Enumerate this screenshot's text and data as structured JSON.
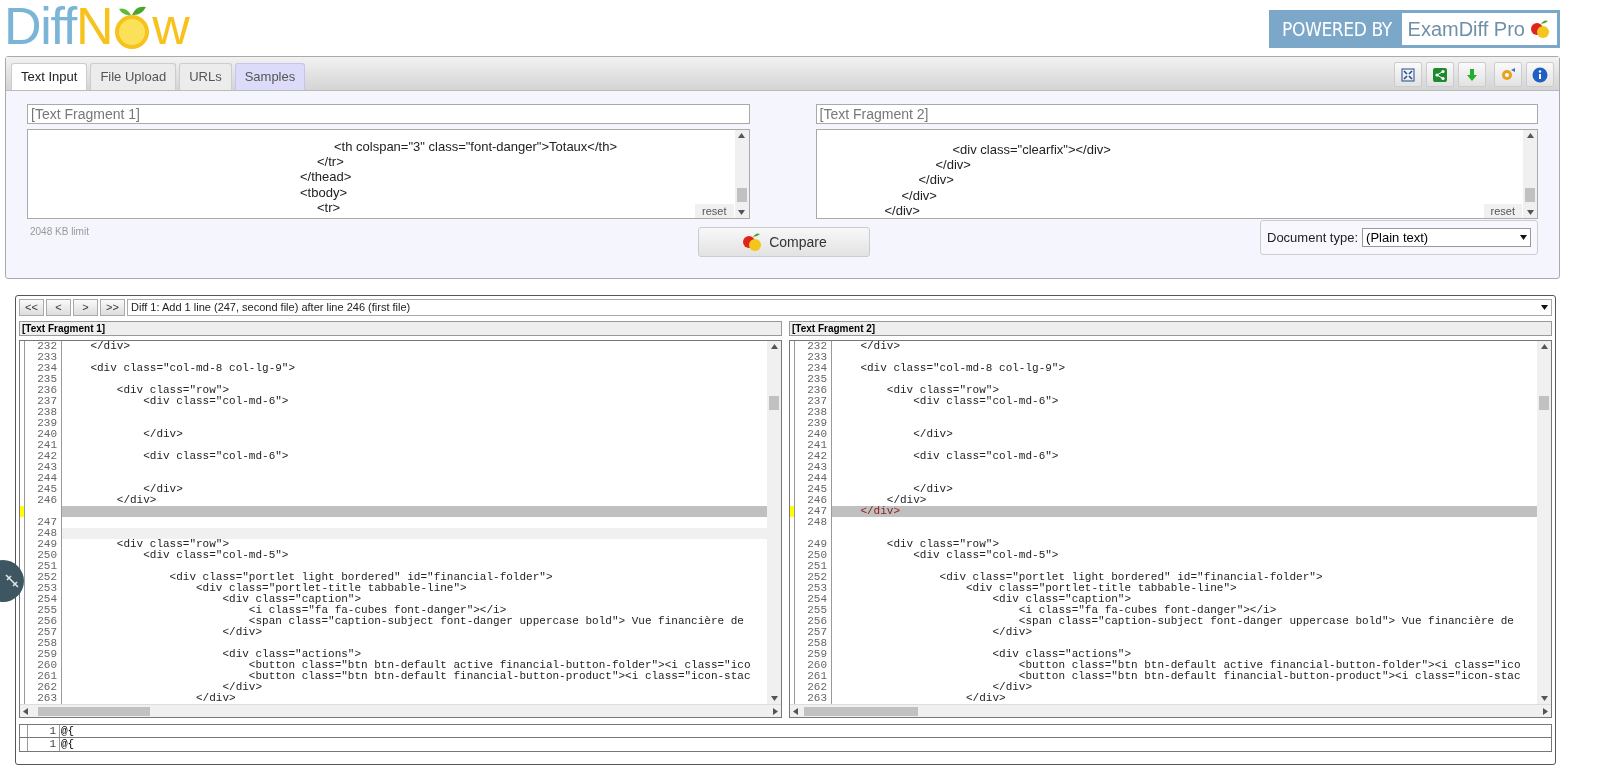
{
  "logo": {
    "text_1": "Diff",
    "text_2": "N",
    "text_3": "w"
  },
  "powered_by": {
    "label": "POWERED BY",
    "product": "ExamDiff Pro"
  },
  "tabs": [
    {
      "label": "Text Input",
      "selected": true,
      "highlighted": false
    },
    {
      "label": "File Upload",
      "selected": false,
      "highlighted": false
    },
    {
      "label": "URLs",
      "selected": false,
      "highlighted": false
    },
    {
      "label": "Samples",
      "selected": false,
      "highlighted": true
    }
  ],
  "inputs": [
    {
      "title": "[Text Fragment 1]",
      "lines": [
        "\t\t\t\t\t\t\t\t\t\t\t\t\t\t\t\t\t\t<th colspan=\"3\" class=\"font-danger\">Totaux</th>",
        "\t\t\t\t\t\t\t\t\t\t\t\t\t\t\t\t\t</tr>",
        "\t\t\t\t\t\t\t\t\t\t\t\t\t\t\t\t</thead>",
        "\t\t\t\t\t\t\t\t\t\t\t\t\t\t\t\t<tbody>",
        "\t\t\t\t\t\t\t\t\t\t\t\t\t\t\t\t\t<tr>"
      ],
      "reset": "reset",
      "limit": "2048 KB limit"
    },
    {
      "title": "[Text Fragment 2]",
      "lines": [
        "\t\t\t\t\t\t\t\t<div class=\"clearfix\"></div>",
        "\t\t\t\t\t\t\t</div>",
        "\t\t\t\t\t\t</div>",
        "\t\t\t\t\t</div>",
        "\t\t\t\t</div>"
      ],
      "reset": "reset"
    }
  ],
  "compare_button": "Compare",
  "document_type": {
    "label": "Document type:",
    "value": "(Plain text)"
  },
  "nav_buttons": [
    "<<",
    "<",
    ">",
    ">>"
  ],
  "diff_selector": "Diff 1: Add 1 line (247, second file) after line 246 (first file)",
  "panes": [
    {
      "title": "[Text Fragment 1]",
      "rows": [
        {
          "number": "232",
          "text": "    </div>",
          "kind": "normal"
        },
        {
          "number": "233",
          "kind": "normal"
        },
        {
          "number": "234",
          "text": "    <div class=\"col-md-8 col-lg-9\">",
          "kind": "normal"
        },
        {
          "number": "235",
          "kind": "normal"
        },
        {
          "number": "236",
          "text": "        <div class=\"row\">",
          "kind": "normal"
        },
        {
          "number": "237",
          "text": "            <div class=\"col-md-6\">",
          "kind": "normal"
        },
        {
          "number": "238",
          "kind": "normal"
        },
        {
          "number": "239",
          "kind": "normal"
        },
        {
          "number": "240",
          "text": "            </div>",
          "kind": "normal"
        },
        {
          "number": "241",
          "kind": "normal"
        },
        {
          "number": "242",
          "text": "            <div class=\"col-md-6\">",
          "kind": "normal"
        },
        {
          "number": "243",
          "kind": "normal"
        },
        {
          "number": "244",
          "kind": "normal"
        },
        {
          "number": "245",
          "text": "            </div>",
          "kind": "normal"
        },
        {
          "number": "246",
          "text": "        </div>",
          "kind": "normal"
        },
        {
          "kind": "changed"
        },
        {
          "number": "247",
          "kind": "normal"
        },
        {
          "number": "248",
          "kind": "dim"
        },
        {
          "number": "249",
          "text": "        <div class=\"row\">",
          "kind": "normal"
        },
        {
          "number": "250",
          "text": "            <div class=\"col-md-5\">",
          "kind": "normal"
        },
        {
          "number": "251",
          "kind": "normal"
        },
        {
          "number": "252",
          "text": "                <div class=\"portlet light bordered\" id=\"financial-folder\">",
          "kind": "normal"
        },
        {
          "number": "253",
          "text": "                    <div class=\"portlet-title tabbable-line\">",
          "kind": "normal"
        },
        {
          "number": "254",
          "text": "                        <div class=\"caption\">",
          "kind": "normal"
        },
        {
          "number": "255",
          "text": "                            <i class=\"fa fa-cubes font-danger\"></i>",
          "kind": "normal"
        },
        {
          "number": "256",
          "text": "                            <span class=\"caption-subject font-danger uppercase bold\"> Vue financière de",
          "kind": "normal"
        },
        {
          "number": "257",
          "text": "                        </div>",
          "kind": "normal"
        },
        {
          "number": "258",
          "kind": "normal"
        },
        {
          "number": "259",
          "text": "                        <div class=\"actions\">",
          "kind": "normal"
        },
        {
          "number": "260",
          "text": "                            <button class=\"btn btn-default active financial-button-folder\"><i class=\"ico",
          "kind": "normal"
        },
        {
          "number": "261",
          "text": "                            <button class=\"btn btn-default financial-button-product\"><i class=\"icon-stac",
          "kind": "normal"
        },
        {
          "number": "262",
          "text": "                        </div>",
          "kind": "normal"
        },
        {
          "number": "263",
          "text": "                    </div>",
          "kind": "normal"
        }
      ]
    },
    {
      "title": "[Text Fragment 2]",
      "rows": [
        {
          "number": "232",
          "text": "    </div>",
          "kind": "normal"
        },
        {
          "number": "233",
          "kind": "normal"
        },
        {
          "number": "234",
          "text": "    <div class=\"col-md-8 col-lg-9\">",
          "kind": "normal"
        },
        {
          "number": "235",
          "kind": "normal"
        },
        {
          "number": "236",
          "text": "        <div class=\"row\">",
          "kind": "normal"
        },
        {
          "number": "237",
          "text": "            <div class=\"col-md-6\">",
          "kind": "normal"
        },
        {
          "number": "238",
          "kind": "normal"
        },
        {
          "number": "239",
          "kind": "normal"
        },
        {
          "number": "240",
          "text": "            </div>",
          "kind": "normal"
        },
        {
          "number": "241",
          "kind": "normal"
        },
        {
          "number": "242",
          "text": "            <div class=\"col-md-6\">",
          "kind": "normal"
        },
        {
          "number": "243",
          "kind": "normal"
        },
        {
          "number": "244",
          "kind": "normal"
        },
        {
          "number": "245",
          "text": "            </div>",
          "kind": "normal"
        },
        {
          "number": "246",
          "text": "        </div>",
          "kind": "normal"
        },
        {
          "number": "247",
          "text": "    </div>",
          "kind": "changed"
        },
        {
          "number": "248",
          "kind": "normal"
        },
        {
          "kind": "normal"
        },
        {
          "number": "249",
          "text": "        <div class=\"row\">",
          "kind": "normal"
        },
        {
          "number": "250",
          "text": "            <div class=\"col-md-5\">",
          "kind": "normal"
        },
        {
          "number": "251",
          "kind": "normal"
        },
        {
          "number": "252",
          "text": "                <div class=\"portlet light bordered\" id=\"financial-folder\">",
          "kind": "normal"
        },
        {
          "number": "253",
          "text": "                    <div class=\"portlet-title tabbable-line\">",
          "kind": "normal"
        },
        {
          "number": "254",
          "text": "                        <div class=\"caption\">",
          "kind": "normal"
        },
        {
          "number": "255",
          "text": "                            <i class=\"fa fa-cubes font-danger\"></i>",
          "kind": "normal"
        },
        {
          "number": "256",
          "text": "                            <span class=\"caption-subject font-danger uppercase bold\"> Vue financière de",
          "kind": "normal"
        },
        {
          "number": "257",
          "text": "                        </div>",
          "kind": "normal"
        },
        {
          "number": "258",
          "kind": "normal"
        },
        {
          "number": "259",
          "text": "                        <div class=\"actions\">",
          "kind": "normal"
        },
        {
          "number": "260",
          "text": "                            <button class=\"btn btn-default active financial-button-folder\"><i class=\"ico",
          "kind": "normal"
        },
        {
          "number": "261",
          "text": "                            <button class=\"btn btn-default financial-button-product\"><i class=\"icon-stac",
          "kind": "normal"
        },
        {
          "number": "262",
          "text": "                        </div>",
          "kind": "normal"
        },
        {
          "number": "263",
          "text": "                    </div>",
          "kind": "normal"
        }
      ]
    }
  ],
  "line_view": [
    {
      "number": "1",
      "text": "@{"
    },
    {
      "number": "1",
      "text": "@{"
    }
  ]
}
